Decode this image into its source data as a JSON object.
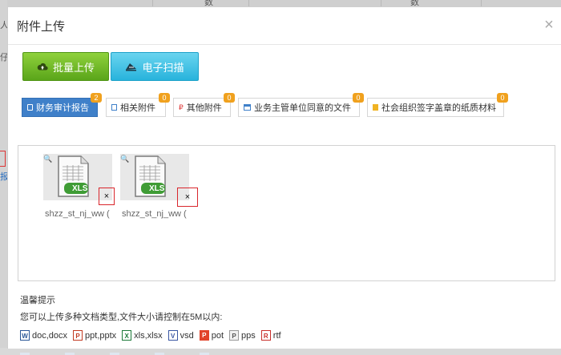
{
  "background": {
    "top_frag_1": "数",
    "top_frag_2": "数",
    "left_frag_1": "人",
    "left_frag_2": "仔",
    "left_frag_3": "报"
  },
  "modal": {
    "title": "附件上传",
    "close_label": "×"
  },
  "toolbar": {
    "batch_upload_label": "批量上传",
    "scan_label": "电子扫描"
  },
  "tabs": [
    {
      "label": "财务审计报告",
      "count": "2",
      "active": true
    },
    {
      "label": "相关附件",
      "count": "0",
      "active": false
    },
    {
      "label": "其他附件",
      "count": "0",
      "active": false
    },
    {
      "label": "业务主管单位同意的文件",
      "count": "0",
      "active": false
    },
    {
      "label": "社会组织签字盖章的纸质材料",
      "count": "0",
      "active": false
    }
  ],
  "files": [
    {
      "name": "shzz_st_nj_ww (",
      "type_label": "XLS",
      "delete_label": "×"
    },
    {
      "name": "shzz_st_nj_ww (",
      "type_label": "XLS",
      "delete_label": "×"
    }
  ],
  "tips": {
    "title": "温馨提示",
    "text": "您可以上传多种文档类型,文件大小请控制在5M以内:",
    "types": [
      {
        "label": "doc,docx",
        "icon": "word-icon",
        "glyph": "W"
      },
      {
        "label": "ppt,pptx",
        "icon": "ppt-icon",
        "glyph": "P"
      },
      {
        "label": "xls,xlsx",
        "icon": "excel-icon",
        "glyph": "X"
      },
      {
        "label": "vsd",
        "icon": "visio-icon",
        "glyph": "V"
      },
      {
        "label": "pot",
        "icon": "pot-icon",
        "glyph": "P"
      },
      {
        "label": "pps",
        "icon": "pps-icon",
        "glyph": "P"
      },
      {
        "label": "rtf",
        "icon": "rtf-icon",
        "glyph": "R"
      }
    ]
  },
  "colors": {
    "green_button": "#5aa51a",
    "cyan_button": "#27b3dc",
    "active_tab": "#3f80c9",
    "badge": "#f0a11e",
    "delete_highlight": "#d9262c"
  }
}
